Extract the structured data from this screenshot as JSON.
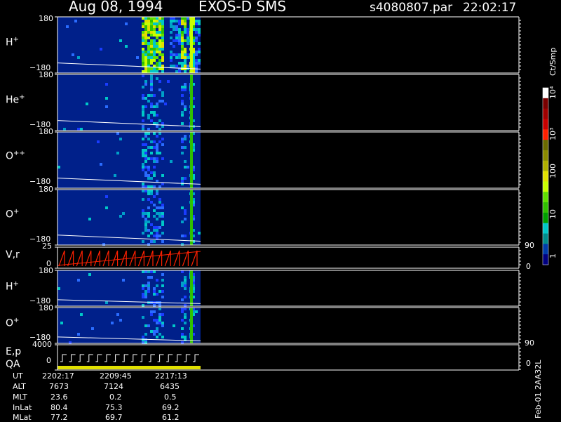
{
  "header": {
    "date": "Aug 08, 1994",
    "instrument": "EXOS-D SMS",
    "file": "s4080807.par",
    "time": "22:02:17"
  },
  "panels": [
    {
      "label_main": "H",
      "label_sup": "+",
      "top_tick": "180",
      "bot_tick": "−180"
    },
    {
      "label_main": "He",
      "label_sup": "+",
      "top_tick": "180",
      "bot_tick": "−180"
    },
    {
      "label_main": "O",
      "label_sup": "++",
      "top_tick": "180",
      "bot_tick": "−180"
    },
    {
      "label_main": "O",
      "label_sup": "+",
      "top_tick": "180",
      "bot_tick": "−180"
    },
    {
      "label_main": "V,r",
      "top_tick": "25",
      "bot_tick": "0",
      "right_top": "90",
      "right_bot": "0"
    },
    {
      "label_main": "H",
      "label_sup": "+",
      "top_tick": "180",
      "bot_tick": "−180"
    },
    {
      "label_main": "O",
      "label_sup": "+",
      "top_tick": "180",
      "bot_tick": "−180"
    },
    {
      "label_main": "E,p",
      "label_line2": "QA",
      "top_tick": "4000",
      "bot_tick": "0",
      "right_top": "90",
      "right_bot": "0"
    }
  ],
  "colorbar": {
    "unit": "Ct/Smp",
    "ticks": [
      "10⁴",
      "10³",
      "100",
      "10",
      "1"
    ],
    "colors": [
      "#ffffff",
      "#7a0000",
      "#a00000",
      "#c80000",
      "#ff2000",
      "#6a6a00",
      "#8a8a00",
      "#b0b000",
      "#e0e000",
      "#c8ff00",
      "#60e000",
      "#30c000",
      "#00a000",
      "#00c8c8",
      "#008c8c",
      "#003caa",
      "#000080"
    ]
  },
  "footer": {
    "rows": [
      {
        "name": "UT",
        "values": [
          "2202:17",
          "2209:45",
          "2217:13"
        ]
      },
      {
        "name": "ALT",
        "values": [
          "7673",
          "7124",
          "6435"
        ]
      },
      {
        "name": "MLT",
        "values": [
          "23.6",
          "0.2",
          "0.5"
        ]
      },
      {
        "name": "InLat",
        "values": [
          "80.4",
          "75.3",
          "69.2"
        ]
      },
      {
        "name": "MLat",
        "values": [
          "77.2",
          "69.7",
          "61.2"
        ]
      }
    ],
    "side_label": "Feb-01  2AA32L"
  },
  "chart_data": {
    "type": "heatmap",
    "title": "Aug 08, 1994   EXOS-D SMS",
    "x": [
      "2202:17",
      "2209:45",
      "2217:13"
    ],
    "series": [
      {
        "name": "H+",
        "ylim": [
          -180,
          180
        ]
      },
      {
        "name": "He+",
        "ylim": [
          -180,
          180
        ]
      },
      {
        "name": "O++",
        "ylim": [
          -180,
          180
        ]
      },
      {
        "name": "O+",
        "ylim": [
          -180,
          180
        ]
      },
      {
        "name": "V,r",
        "ylim": [
          0,
          25
        ]
      },
      {
        "name": "H+",
        "ylim": [
          -180,
          180
        ]
      },
      {
        "name": "O+",
        "ylim": [
          -180,
          180
        ]
      },
      {
        "name": "E,p",
        "ylim": [
          0,
          4000
        ]
      }
    ],
    "colorbar_range": [
      1,
      10000
    ],
    "colorbar_unit": "Ct/Smp"
  }
}
